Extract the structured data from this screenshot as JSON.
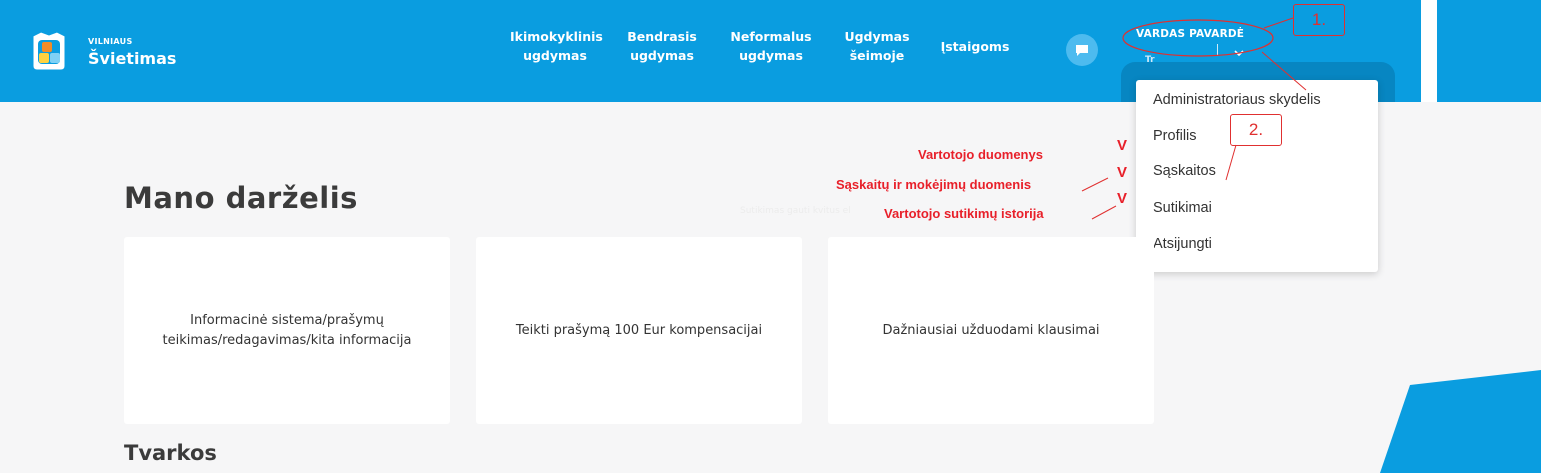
{
  "brand": {
    "small": "VILNIAUS",
    "big": "Švietimas"
  },
  "nav": [
    {
      "line1": "Ikimokyklinis",
      "line2": "ugdymas"
    },
    {
      "line1": "Bendrasis",
      "line2": "ugdymas"
    },
    {
      "line1": "Neformalus",
      "line2": "ugdymas"
    },
    {
      "line1": "Ugdymas",
      "line2": "šeimoje"
    },
    {
      "line1": "Įstaigoms",
      "line2": ""
    }
  ],
  "user": {
    "name": "VARDAS PAVARDĖ",
    "role": "Tr"
  },
  "dropdown": {
    "items": [
      "Administratoriaus skydelis",
      "Profilis",
      "Sąskaitos",
      "Sutikimai",
      "Atsijungti"
    ]
  },
  "main": {
    "title": "Mano darželis",
    "faded_text": "Sutikimas gauti kvitus el",
    "cards": [
      "Informacinė sistema/prašymų teikimas/redagavimas/kita informacija",
      "Teikti prašymą 100 Eur kompensacijai",
      "Dažniausiai užduodami klausimai"
    ],
    "section_title": "Tvarkos"
  },
  "annotations": {
    "box1": "1.",
    "box2": "2.",
    "notes": [
      "Vartotojo duomenys",
      "Sąskaitų ir mokėjimų duomenis",
      "Vartotojo sutikimų istorija"
    ],
    "check": "V"
  },
  "colors": {
    "header": "#0a9de0",
    "header_dark": "#0786c2",
    "background": "#f6f6f7",
    "annotation": "#e8202a"
  }
}
